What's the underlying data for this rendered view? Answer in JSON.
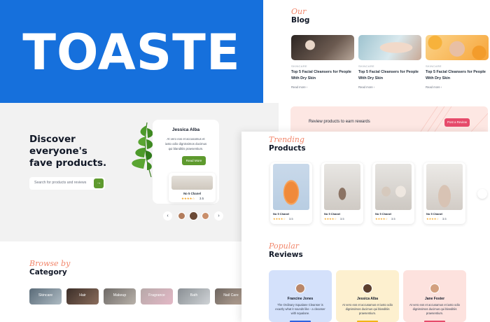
{
  "logo": {
    "text": "TOASTE"
  },
  "blog": {
    "script": "Our",
    "title": "Blog",
    "posts": [
      {
        "category": "SKINCARE",
        "title": "Top 5 Facial Cleansers for People With Dry Skin",
        "more": "Read more  ›"
      },
      {
        "category": "SKINCARE",
        "title": "Top 5 Facial Cleansers for People With Dry Skin",
        "more": "Read more  ›"
      },
      {
        "category": "SKINCARE",
        "title": "Top 5 Facial Cleansers for People With Dry Skin",
        "more": "Read more  ›"
      }
    ]
  },
  "hero": {
    "title_line1": "Discover",
    "title_line2": "everyone's",
    "title_line3": "fave products.",
    "search_placeholder": "Search for products and reviews",
    "search_button_icon": "arrow-right-icon",
    "review_card": {
      "name": "Jessica Alba",
      "text": "At vero eos et accusamus et iusto odio dignissimos ducimus qui blanditiis praesentium.",
      "button": "Read More"
    },
    "mini_product": {
      "name": "No 5 Chanel",
      "stars": "★★★★☆",
      "rating": "3.5"
    },
    "prev": "‹",
    "next": "›"
  },
  "category": {
    "script": "Browse by",
    "title": "Category",
    "items": [
      "Skincare",
      "Hair",
      "Makeup",
      "Fragrance",
      "Bath",
      "Nail Care"
    ]
  },
  "reward": {
    "text": "Review products to earn rewards",
    "button": "Post a Review"
  },
  "products": {
    "script": "Trending",
    "title": "Products",
    "items": [
      {
        "name": "No 5 Chanel",
        "stars": "★★★★☆",
        "rating": "3.5"
      },
      {
        "name": "No 5 Chanel",
        "stars": "★★★★☆",
        "rating": "3.5"
      },
      {
        "name": "No 5 Chanel",
        "stars": "★★★★☆",
        "rating": "3.5"
      },
      {
        "name": "No 5 Chanel",
        "stars": "★★★★☆",
        "rating": "3.5"
      }
    ]
  },
  "reviews": {
    "script": "Popular",
    "title": "Reviews",
    "items": [
      {
        "name": "Francine Jones",
        "text": "The Ordinary Squalane Cleanser is exactly what it sounds like - a cleanser with squalane."
      },
      {
        "name": "Jessica Alba",
        "text": "At vero eos et accusamus et iusto odio dignissimos ducimus qui blanditiis praesentium."
      },
      {
        "name": "Jane Foster",
        "text": "At vero eos et accusamus et iusto odio dignissimos ducimus qui blanditiis praesentium."
      }
    ]
  },
  "colors": {
    "brand_blue": "#1670dc",
    "accent_green": "#5e9a2e",
    "accent_pink": "#e64b6b",
    "script_coral": "#f2876c"
  }
}
